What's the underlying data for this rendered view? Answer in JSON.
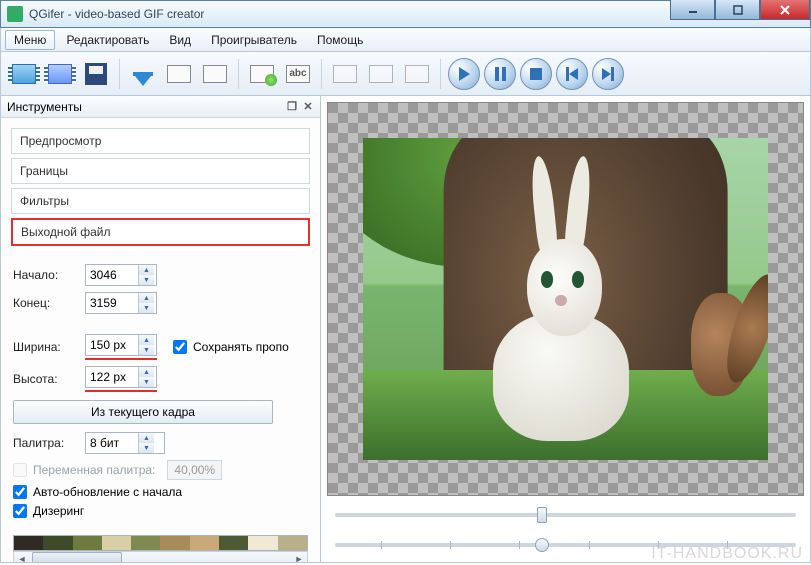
{
  "window": {
    "title": "QGifer - video-based GIF creator"
  },
  "menu": {
    "items": [
      "Меню",
      "Редактировать",
      "Вид",
      "Проигрыватель",
      "Помощь"
    ],
    "activeIndex": 0
  },
  "toolbar": {
    "group1": [
      "open-video-icon",
      "reel-icon",
      "save-icon"
    ],
    "group2": [
      "import-frame-icon",
      "frame-prev-icon",
      "frame-next-icon"
    ],
    "group3": [
      "add-frame-icon",
      "abc-frame-icon"
    ],
    "group4": [
      "edit-icon",
      "crop-icon",
      "clip-icon"
    ],
    "playback": [
      "play-icon",
      "pause-icon",
      "stop-icon",
      "skip-back-icon",
      "skip-fwd-icon"
    ]
  },
  "panel": {
    "title": "Инструменты",
    "sections": {
      "preview": "Предпросмотр",
      "bounds": "Границы",
      "filters": "Фильтры",
      "output": "Выходной файл"
    },
    "fields": {
      "start_label": "Начало:",
      "start_value": "3046",
      "end_label": "Конец:",
      "end_value": "3159",
      "width_label": "Ширина:",
      "width_value": "150 px",
      "height_label": "Высота:",
      "height_value": "122 px",
      "keep_ratio_label": "Сохранять пропо",
      "keep_ratio_checked": true,
      "from_current_frame": "Из текущего кадра",
      "palette_label": "Палитра:",
      "palette_value": "8 бит",
      "var_palette_label": "Переменная палитра:",
      "var_palette_pct": "40,00%",
      "var_palette_checked": false,
      "auto_update_label": "Авто-обновление с начала",
      "auto_update_checked": true,
      "dithering_label": "Дизеринг",
      "dithering_checked": true
    },
    "palette_colors": [
      "#2f2a24",
      "#3d4b2a",
      "#6f7a3e",
      "#d9cfa7",
      "#7e8a4f",
      "#a78b58",
      "#c9a978",
      "#4d5a33",
      "#efe9d6",
      "#b9b08a"
    ]
  },
  "sliders": {
    "position_pct": 45,
    "zoom_pct": 45
  },
  "watermark": "IT-HANDBOOK.RU"
}
